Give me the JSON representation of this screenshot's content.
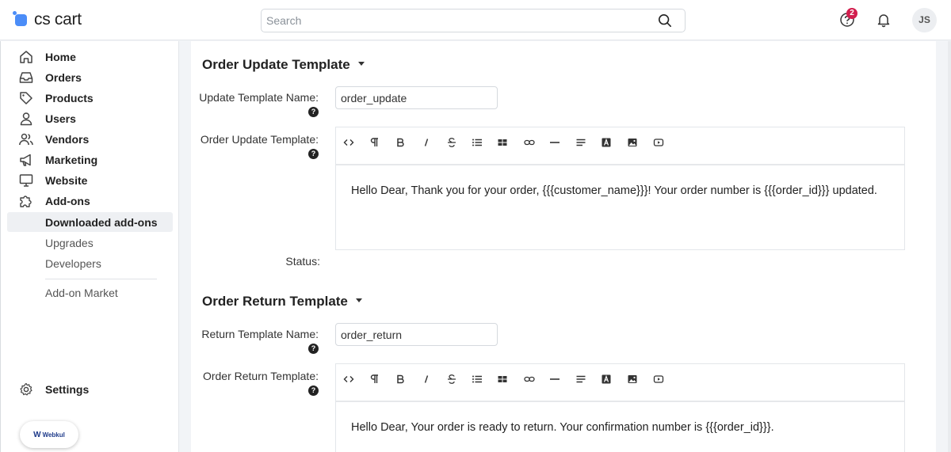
{
  "header": {
    "logo_text": "cs cart",
    "search_placeholder": "Search",
    "help_badge": "2",
    "avatar_initials": "JS"
  },
  "sidebar": {
    "items": [
      {
        "label": "Home",
        "icon": "home-icon"
      },
      {
        "label": "Orders",
        "icon": "inbox-icon"
      },
      {
        "label": "Products",
        "icon": "tag-icon"
      },
      {
        "label": "Users",
        "icon": "user-icon"
      },
      {
        "label": "Vendors",
        "icon": "users-icon"
      },
      {
        "label": "Marketing",
        "icon": "megaphone-icon"
      },
      {
        "label": "Website",
        "icon": "monitor-icon"
      },
      {
        "label": "Add-ons",
        "icon": "puzzle-icon"
      }
    ],
    "subitems": [
      {
        "label": "Downloaded add-ons",
        "active": true
      },
      {
        "label": "Upgrades",
        "active": false
      },
      {
        "label": "Developers",
        "active": false
      },
      {
        "label": "Add-on Market",
        "active": false
      }
    ],
    "settings_label": "Settings",
    "webkul_label": "Webkul"
  },
  "main": {
    "update_section": {
      "title": "Order Update Template",
      "name_label": "Update Template Name:",
      "name_value": "order_update",
      "template_label": "Order Update Template:",
      "template_body": "Hello Dear, Thank you for your order, {{{customer_name}}}! Your order number is {{{order_id}}} updated.",
      "status_label": "Status:"
    },
    "return_section": {
      "title": "Order Return Template",
      "name_label": "Return Template Name:",
      "name_value": "order_return",
      "template_label": "Order Return Template:",
      "template_body": "Hello Dear, Your order is ready to return. Your confirmation number is {{{order_id}}}."
    },
    "help_mark": "?",
    "toolbar": [
      "code-view-icon",
      "paragraph-icon",
      "bold-icon",
      "italic-icon",
      "strikethrough-icon",
      "bullet-list-icon",
      "table-icon",
      "link-icon",
      "horizontal-rule-icon",
      "align-icon",
      "font-color-icon",
      "image-icon",
      "video-icon"
    ]
  },
  "colors": {
    "brand": "#4b8df8",
    "badge": "#d21f4e",
    "active_bg": "#eef0f3"
  }
}
